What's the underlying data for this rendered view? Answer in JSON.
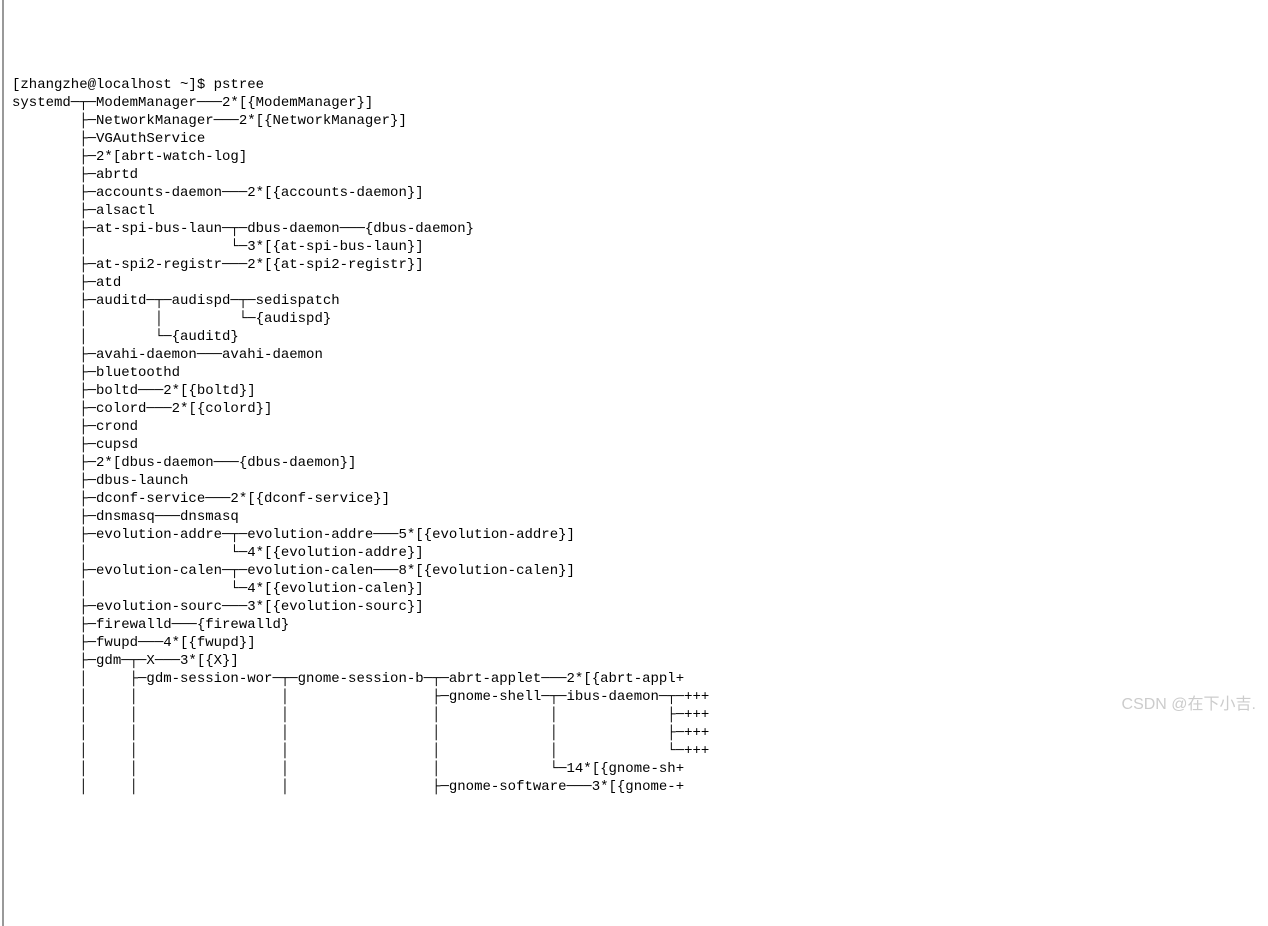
{
  "prompt": "[zhangzhe@localhost ~]$ pstree",
  "tree": [
    "systemd─┬─ModemManager───2*[{ModemManager}]",
    "        ├─NetworkManager───2*[{NetworkManager}]",
    "        ├─VGAuthService",
    "        ├─2*[abrt-watch-log]",
    "        ├─abrtd",
    "        ├─accounts-daemon───2*[{accounts-daemon}]",
    "        ├─alsactl",
    "        ├─at-spi-bus-laun─┬─dbus-daemon───{dbus-daemon}",
    "        │                 └─3*[{at-spi-bus-laun}]",
    "        ├─at-spi2-registr───2*[{at-spi2-registr}]",
    "        ├─atd",
    "        ├─auditd─┬─audispd─┬─sedispatch",
    "        │        │         └─{audispd}",
    "        │        └─{auditd}",
    "        ├─avahi-daemon───avahi-daemon",
    "        ├─bluetoothd",
    "        ├─boltd───2*[{boltd}]",
    "        ├─colord───2*[{colord}]",
    "        ├─crond",
    "        ├─cupsd",
    "        ├─2*[dbus-daemon───{dbus-daemon}]",
    "        ├─dbus-launch",
    "        ├─dconf-service───2*[{dconf-service}]",
    "        ├─dnsmasq───dnsmasq",
    "        ├─evolution-addre─┬─evolution-addre───5*[{evolution-addre}]",
    "        │                 └─4*[{evolution-addre}]",
    "        ├─evolution-calen─┬─evolution-calen───8*[{evolution-calen}]",
    "        │                 └─4*[{evolution-calen}]",
    "        ├─evolution-sourc───3*[{evolution-sourc}]",
    "        ├─firewalld───{firewalld}",
    "        ├─fwupd───4*[{fwupd}]",
    "        ├─gdm─┬─X───3*[{X}]",
    "        │     ├─gdm-session-wor─┬─gnome-session-b─┬─abrt-applet───2*[{abrt-appl+",
    "        │     │                 │                 ├─gnome-shell─┬─ibus-daemon─┬─+++",
    "        │     │                 │                 │             │             ├─+++",
    "        │     │                 │                 │             │             ├─+++",
    "        │     │                 │                 │             │             └─+++",
    "        │     │                 │                 │             └─14*[{gnome-sh+",
    "        │     │                 │                 ├─gnome-software───3*[{gnome-+"
  ],
  "watermark": "CSDN @在下小吉."
}
